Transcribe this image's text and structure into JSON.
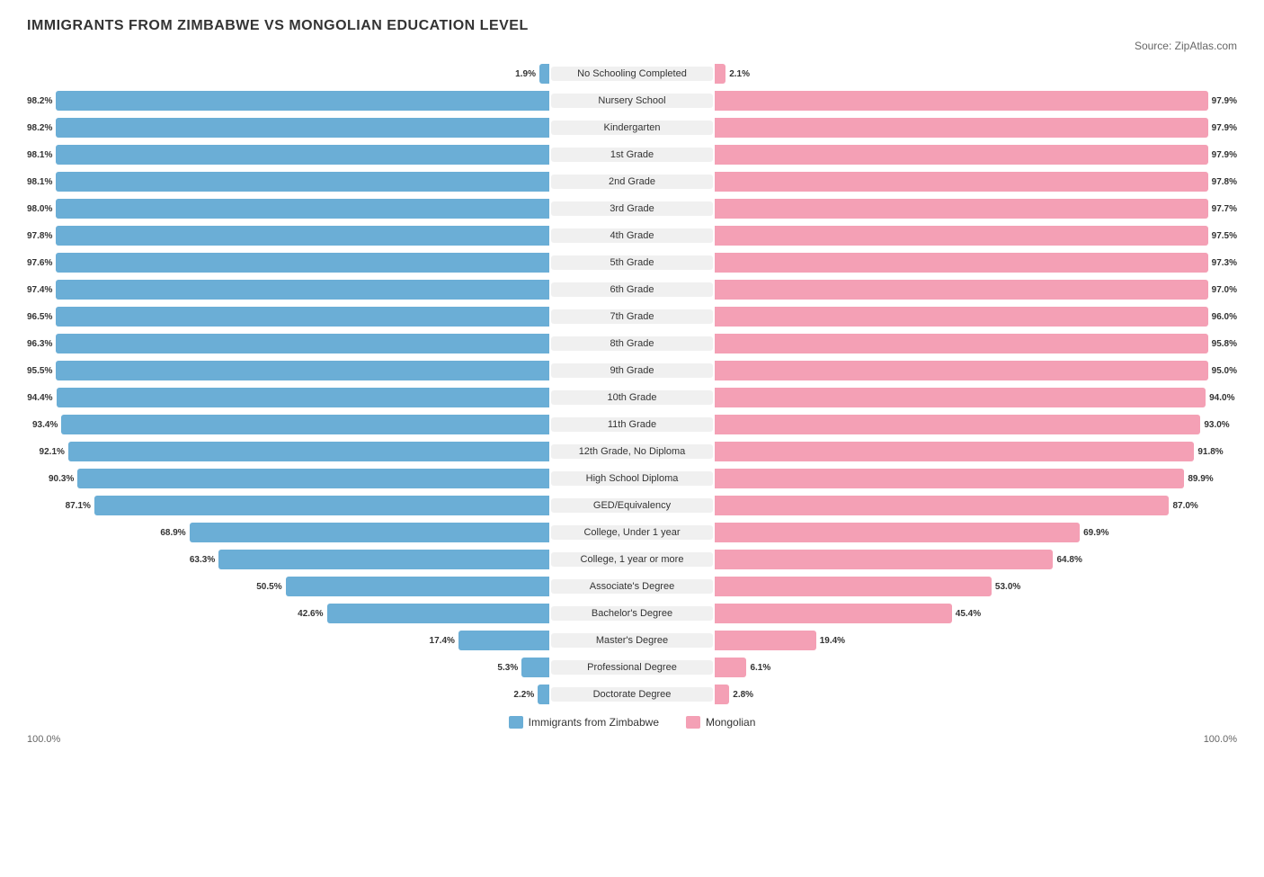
{
  "title": "IMMIGRANTS FROM ZIMBABWE VS MONGOLIAN EDUCATION LEVEL",
  "source": "Source: ZipAtlas.com",
  "legend": {
    "left_label": "Immigrants from Zimbabwe",
    "right_label": "Mongolian",
    "left_color": "#6baed6",
    "right_color": "#f4a0b5"
  },
  "axis": {
    "left": "100.0%",
    "right": "100.0%"
  },
  "rows": [
    {
      "label": "No Schooling Completed",
      "left_val": "1.9%",
      "right_val": "2.1%",
      "left_pct": 1.9,
      "right_pct": 2.1
    },
    {
      "label": "Nursery School",
      "left_val": "98.2%",
      "right_val": "97.9%",
      "left_pct": 98.2,
      "right_pct": 97.9
    },
    {
      "label": "Kindergarten",
      "left_val": "98.2%",
      "right_val": "97.9%",
      "left_pct": 98.2,
      "right_pct": 97.9
    },
    {
      "label": "1st Grade",
      "left_val": "98.1%",
      "right_val": "97.9%",
      "left_pct": 98.1,
      "right_pct": 97.9
    },
    {
      "label": "2nd Grade",
      "left_val": "98.1%",
      "right_val": "97.8%",
      "left_pct": 98.1,
      "right_pct": 97.8
    },
    {
      "label": "3rd Grade",
      "left_val": "98.0%",
      "right_val": "97.7%",
      "left_pct": 98.0,
      "right_pct": 97.7
    },
    {
      "label": "4th Grade",
      "left_val": "97.8%",
      "right_val": "97.5%",
      "left_pct": 97.8,
      "right_pct": 97.5
    },
    {
      "label": "5th Grade",
      "left_val": "97.6%",
      "right_val": "97.3%",
      "left_pct": 97.6,
      "right_pct": 97.3
    },
    {
      "label": "6th Grade",
      "left_val": "97.4%",
      "right_val": "97.0%",
      "left_pct": 97.4,
      "right_pct": 97.0
    },
    {
      "label": "7th Grade",
      "left_val": "96.5%",
      "right_val": "96.0%",
      "left_pct": 96.5,
      "right_pct": 96.0
    },
    {
      "label": "8th Grade",
      "left_val": "96.3%",
      "right_val": "95.8%",
      "left_pct": 96.3,
      "right_pct": 95.8
    },
    {
      "label": "9th Grade",
      "left_val": "95.5%",
      "right_val": "95.0%",
      "left_pct": 95.5,
      "right_pct": 95.0
    },
    {
      "label": "10th Grade",
      "left_val": "94.4%",
      "right_val": "94.0%",
      "left_pct": 94.4,
      "right_pct": 94.0
    },
    {
      "label": "11th Grade",
      "left_val": "93.4%",
      "right_val": "93.0%",
      "left_pct": 93.4,
      "right_pct": 93.0
    },
    {
      "label": "12th Grade, No Diploma",
      "left_val": "92.1%",
      "right_val": "91.8%",
      "left_pct": 92.1,
      "right_pct": 91.8
    },
    {
      "label": "High School Diploma",
      "left_val": "90.3%",
      "right_val": "89.9%",
      "left_pct": 90.3,
      "right_pct": 89.9
    },
    {
      "label": "GED/Equivalency",
      "left_val": "87.1%",
      "right_val": "87.0%",
      "left_pct": 87.1,
      "right_pct": 87.0
    },
    {
      "label": "College, Under 1 year",
      "left_val": "68.9%",
      "right_val": "69.9%",
      "left_pct": 68.9,
      "right_pct": 69.9
    },
    {
      "label": "College, 1 year or more",
      "left_val": "63.3%",
      "right_val": "64.8%",
      "left_pct": 63.3,
      "right_pct": 64.8
    },
    {
      "label": "Associate's Degree",
      "left_val": "50.5%",
      "right_val": "53.0%",
      "left_pct": 50.5,
      "right_pct": 53.0
    },
    {
      "label": "Bachelor's Degree",
      "left_val": "42.6%",
      "right_val": "45.4%",
      "left_pct": 42.6,
      "right_pct": 45.4
    },
    {
      "label": "Master's Degree",
      "left_val": "17.4%",
      "right_val": "19.4%",
      "left_pct": 17.4,
      "right_pct": 19.4
    },
    {
      "label": "Professional Degree",
      "left_val": "5.3%",
      "right_val": "6.1%",
      "left_pct": 5.3,
      "right_pct": 6.1
    },
    {
      "label": "Doctorate Degree",
      "left_val": "2.2%",
      "right_val": "2.8%",
      "left_pct": 2.2,
      "right_pct": 2.8
    }
  ]
}
